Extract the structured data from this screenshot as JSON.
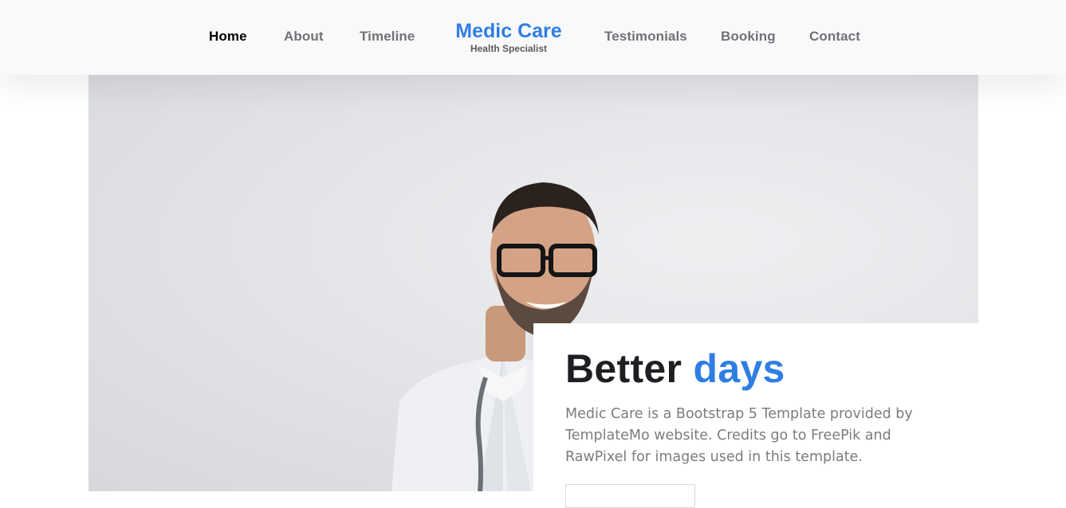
{
  "nav": {
    "items": [
      {
        "label": "Home",
        "active": true
      },
      {
        "label": "About"
      },
      {
        "label": "Timeline"
      },
      {
        "label": "Testimonials"
      },
      {
        "label": "Booking"
      },
      {
        "label": "Contact"
      }
    ],
    "brand_title": "Medic Care",
    "brand_subtitle": "Health Specialist"
  },
  "hero": {
    "title_main": "Better",
    "title_accent": "days",
    "text": "Medic Care is a Bootstrap 5 Template provided by TemplateMo website. Credits go to FreePik and RawPixel for images used in this template."
  },
  "colors": {
    "accent": "#2f7ee3",
    "nav_bg": "#f8f9fa",
    "text_dark": "#1e1f22",
    "text_muted": "#7b7c80"
  }
}
